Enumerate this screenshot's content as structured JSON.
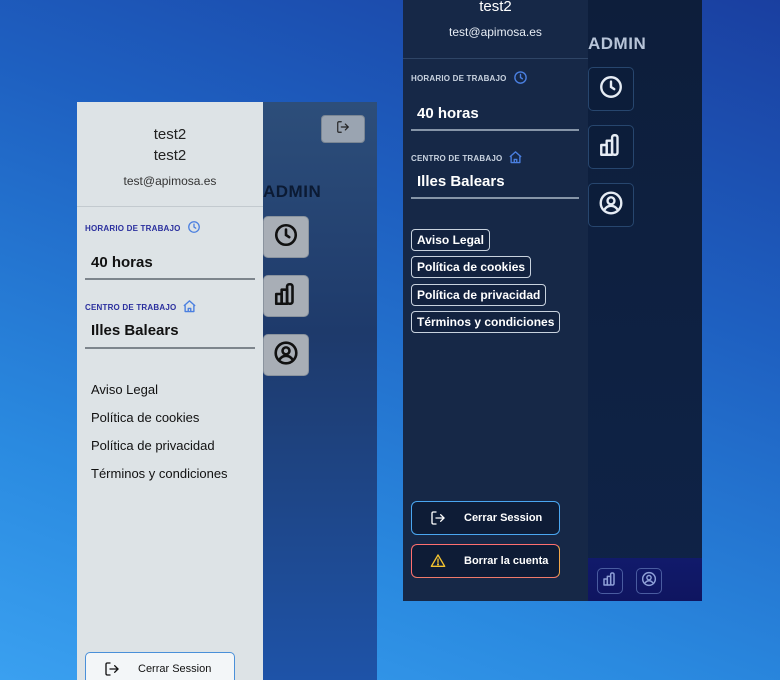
{
  "user": {
    "name_line1": "test2",
    "name_line2": "test2",
    "email": "test@apimosa.es"
  },
  "admin_title": "ADMIN",
  "sections": {
    "horario_label": "HORARIO DE TRABAJO",
    "horario_value": "40 horas",
    "centro_label": "CENTRO DE TRABAJO",
    "centro_value": "Illes Balears"
  },
  "links": [
    "Aviso Legal",
    "Política de cookies",
    "Política de privacidad",
    "Términos y condiciones"
  ],
  "actions": {
    "logout_label": "Cerrar Session",
    "delete_label": "Borrar la cuenta"
  },
  "icons": {
    "logout": "logout-arrow-icon",
    "clock": "clock-icon",
    "home": "home-icon",
    "chart": "bar-chart-icon",
    "user": "user-circle-icon",
    "warning": "warning-triangle-icon"
  },
  "colors": {
    "background_gradient": [
      "#1a3fa0",
      "#3aa0f0"
    ],
    "light_drawer": "#dde3e6",
    "dark_drawer": "#162847",
    "accent_label": "#2a2f9e",
    "icon_blue": "#4a7fe0",
    "logout_border": "#4aa6f0",
    "delete_border": "#ff6f6f",
    "warning_yellow": "#f4c430"
  }
}
